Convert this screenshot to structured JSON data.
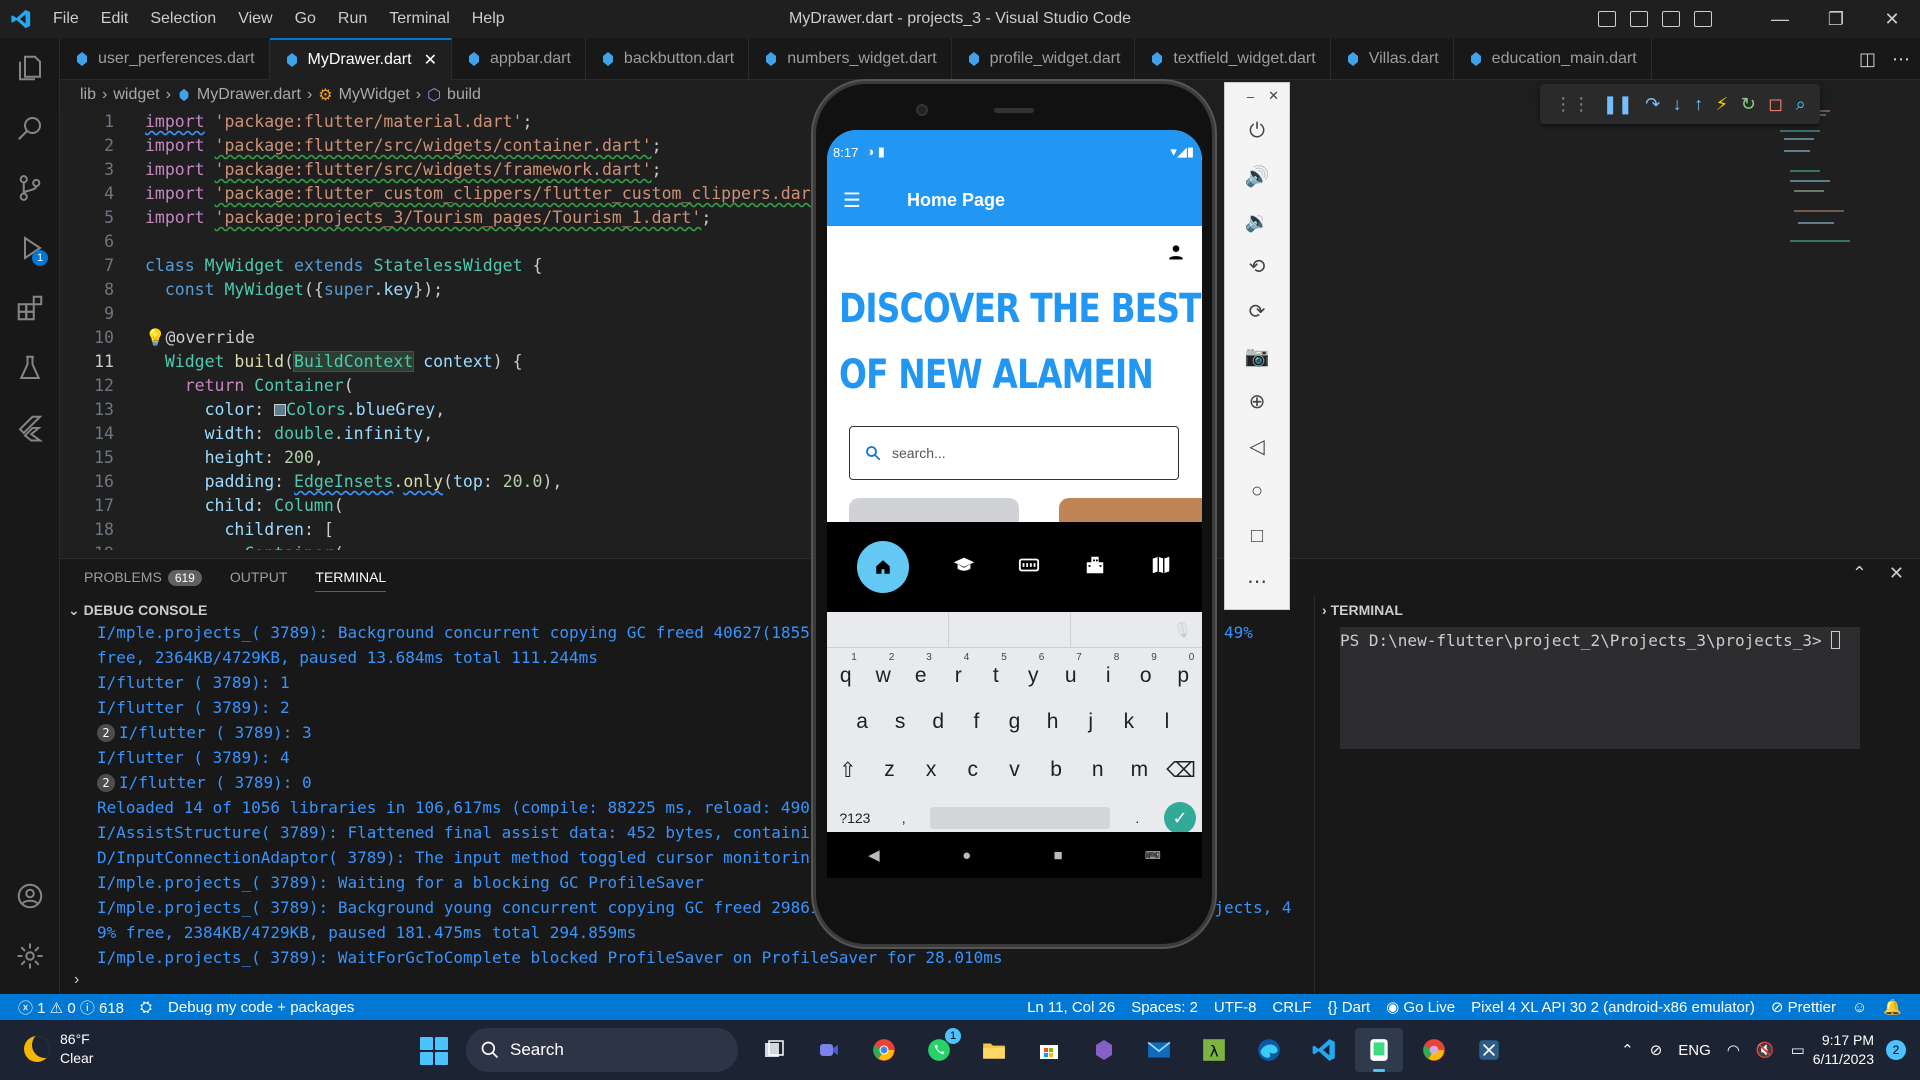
{
  "window": {
    "title": "MyDrawer.dart - projects_3 - Visual Studio Code",
    "menu": [
      "File",
      "Edit",
      "Selection",
      "View",
      "Go",
      "Run",
      "Terminal",
      "Help"
    ]
  },
  "tabs": [
    {
      "label": "user_perferences.dart",
      "active": false
    },
    {
      "label": "MyDrawer.dart",
      "active": true
    },
    {
      "label": "appbar.dart",
      "active": false
    },
    {
      "label": "backbutton.dart",
      "active": false
    },
    {
      "label": "numbers_widget.dart",
      "active": false
    },
    {
      "label": "profile_widget.dart",
      "active": false
    },
    {
      "label": "textfield_widget.dart",
      "active": false
    },
    {
      "label": "Villas.dart",
      "active": false
    },
    {
      "label": "education_main.dart",
      "active": false
    }
  ],
  "breadcrumb": [
    "lib",
    "widget",
    "MyDrawer.dart",
    "MyWidget",
    "build"
  ],
  "activity_badge": "1",
  "editor": {
    "current_line": 11
  },
  "panel": {
    "tabs": [
      "PROBLEMS",
      "OUTPUT",
      "TERMINAL"
    ],
    "problems_count": "619",
    "debug_console_title": "DEBUG CONSOLE",
    "terminal_title": "TERMINAL",
    "terminal_prompt": "PS D:\\new-flutter\\project_2\\Projects_3\\projects_3> ",
    "console_lines": [
      {
        "rep": "",
        "text": "I/mple.projects_( 3789): Background concurrent copying GC freed 40627(1855KB) AllocSpace objects, 0(0B) LOS objects, 49%"
      },
      {
        "rep": "",
        "text": "free, 2364KB/4729KB, paused 13.684ms total 111.244ms"
      },
      {
        "rep": "",
        "text": "I/flutter ( 3789): 1"
      },
      {
        "rep": "",
        "text": "I/flutter ( 3789): 2"
      },
      {
        "rep": "2",
        "text": "I/flutter ( 3789): 3"
      },
      {
        "rep": "",
        "text": "I/flutter ( 3789): 4"
      },
      {
        "rep": "2",
        "text": "I/flutter ( 3789): 0"
      },
      {
        "rep": "",
        "text": "Reloaded 14 of 1056 libraries in 106,617ms (compile: 88225 ms, reload: 490"
      },
      {
        "rep": "",
        "text": "I/AssistStructure( 3789): Flattened final assist data: 452 bytes, containi"
      },
      {
        "rep": "",
        "text": "D/InputConnectionAdaptor( 3789): The input method toggled cursor monitorin"
      },
      {
        "rep": "",
        "text": "I/mple.projects_( 3789): Waiting for a blocking GC ProfileSaver"
      },
      {
        "rep": "",
        "text": "I/mple.projects_( 3789): Background young concurrent copying GC freed 29861(1346KB) AllocSpace objects, 0(0B) LOS objects, 4"
      },
      {
        "rep": "",
        "text": "9% free, 2384KB/4729KB, paused 181.475ms total 294.859ms"
      },
      {
        "rep": "",
        "text": "I/mple.projects_( 3789): WaitForGcToComplete blocked ProfileSaver on ProfileSaver for 28.010ms"
      }
    ]
  },
  "statusbar": {
    "errors": "1",
    "warnings": "0",
    "infos": "618",
    "debug": "Debug my code + packages",
    "position": "Ln 11, Col 26",
    "spaces": "Spaces: 2",
    "encoding": "UTF-8",
    "eol": "CRLF",
    "language": "Dart",
    "golive": "Go Live",
    "device": "Pixel 4 XL API 30 2 (android-x86 emulator)",
    "prettier": "Prettier"
  },
  "phone": {
    "time": "8:17",
    "appbar_title": "Home Page",
    "hero_line1": "DISCOVER THE BEST",
    "hero_line2": "OF NEW ALAMEIN",
    "search_placeholder": "search...",
    "keyboard": {
      "row1": [
        "q",
        "w",
        "e",
        "r",
        "t",
        "y",
        "u",
        "i",
        "o",
        "p"
      ],
      "row1_nums": [
        "1",
        "2",
        "3",
        "4",
        "5",
        "6",
        "7",
        "8",
        "9",
        "0"
      ],
      "row2": [
        "a",
        "s",
        "d",
        "f",
        "g",
        "h",
        "j",
        "k",
        "l"
      ],
      "row3": [
        "z",
        "x",
        "c",
        "v",
        "b",
        "n",
        "m"
      ],
      "sym": "?123",
      "comma": ",",
      "period": "."
    }
  },
  "taskbar": {
    "temp": "86°F",
    "condition": "Clear",
    "search": "Search",
    "lang": "ENG",
    "time": "9:17 PM",
    "date": "6/11/2023",
    "notifications": "2",
    "whatsapp_badge": "1"
  },
  "colors": {
    "accent": "#0078d4",
    "flutter_blue": "#2196f3",
    "console_blue": "#3794ff"
  }
}
